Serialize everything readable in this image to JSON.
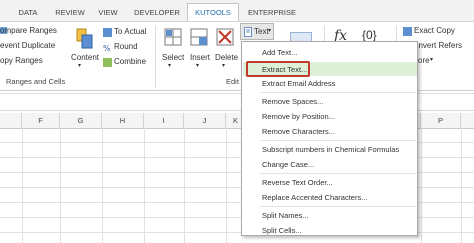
{
  "tabs": [
    "DATA",
    "REVIEW",
    "VIEW",
    "DEVELOPER",
    "KUTOOLS",
    "ENTERPRISE"
  ],
  "active_tab": "KUTOOLS",
  "ribbon": {
    "compare_ranges": "ompare Ranges",
    "prevent_duplicate": "event Duplicate",
    "copy_ranges": "opy Ranges",
    "ranges_and_cells": "Ranges and Cells",
    "content": "Content",
    "to_actual": "To Actual",
    "round": "Round",
    "combine": "Combine",
    "select": "Select",
    "insert": "Insert",
    "delete": "Delete",
    "editing_partial": "Edit",
    "text_button": "Text",
    "exact_copy": "Exact Copy",
    "convert_refers": "onvert Refers",
    "more": "ore",
    "fx": "fx",
    "braces": "{0}"
  },
  "columns": [
    "F",
    "G",
    "H",
    "I",
    "J",
    "K",
    "P"
  ],
  "text_menu": {
    "items": [
      "Add Text...",
      "Extract Text...",
      "Extract Email Address",
      "Remove Spaces...",
      "Remove by Position...",
      "Remove Characters...",
      "Subscript numbers in Chemical Formulas",
      "Change Case...",
      "Reverse Text Order...",
      "Replace Accented Characters...",
      "Split Names...",
      "Split Cells..."
    ],
    "highlighted": "Extract Text..."
  },
  "colors": {
    "accent_blue": "#1f6fb5",
    "highlight_green": "#dff0d8",
    "callout_red": "#c0392b"
  }
}
